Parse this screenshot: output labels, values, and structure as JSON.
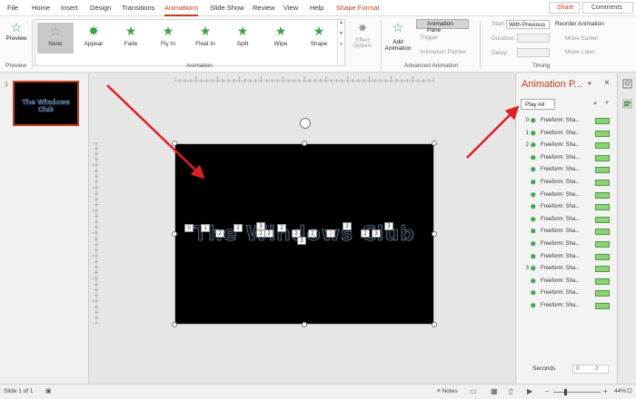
{
  "menubar": {
    "items": [
      "File",
      "Home",
      "Insert",
      "Design",
      "Transitions",
      "Animations",
      "Slide Show",
      "Review",
      "View",
      "Help",
      "Shape Format"
    ],
    "active": "Animations",
    "share": "Share",
    "comments": "Comments"
  },
  "ribbon": {
    "preview": "Preview",
    "preview_group": "Preview",
    "animations": [
      "None",
      "Appear",
      "Fade",
      "Fly In",
      "Float In",
      "Split",
      "Wipe",
      "Shape"
    ],
    "selected_animation": "None",
    "effect_options": "Effect Options",
    "animation_group": "Animation",
    "add_animation": "Add Animation",
    "animation_pane": "Animation Pane",
    "trigger": "Trigger",
    "animation_painter": "Animation Painter",
    "advanced_group": "Advanced Animation",
    "start_label": "Start:",
    "start_value": "With Previous",
    "duration_label": "Duration:",
    "delay_label": "Delay:",
    "reorder": "Reorder Animation",
    "move_earlier": "Move Earlier",
    "move_later": "Move Later",
    "timing_group": "Timing"
  },
  "thumbnails": {
    "slide_number": "1",
    "thumb_text": "The Windows Club"
  },
  "slide": {
    "title": "The Windows Club",
    "tags": [
      "0",
      "1",
      "2",
      "2",
      "3",
      "2",
      "2",
      "2",
      "2",
      "2",
      "3",
      "2",
      "2",
      "2",
      "3",
      "3"
    ]
  },
  "pane": {
    "title": "Animation P...",
    "close": "×",
    "play_all": "Play All",
    "rows": [
      {
        "num": "0",
        "label": "Freeform: Sha..."
      },
      {
        "num": "1",
        "label": "Freeform: Sha..."
      },
      {
        "num": "2",
        "label": "Freeform: Sha..."
      },
      {
        "num": "",
        "label": "Freeform: Sha..."
      },
      {
        "num": "",
        "label": "Freeform: Sha..."
      },
      {
        "num": "",
        "label": "Freeform: Sha..."
      },
      {
        "num": "",
        "label": "Freeform: Sha..."
      },
      {
        "num": "",
        "label": "Freeform: Sha..."
      },
      {
        "num": "",
        "label": "Freeform: Sha..."
      },
      {
        "num": "",
        "label": "Freeform: Sha..."
      },
      {
        "num": "",
        "label": "Freeform: Sha..."
      },
      {
        "num": "",
        "label": "Freeform: Sha..."
      },
      {
        "num": "3",
        "label": "Freeform: Sha..."
      },
      {
        "num": "",
        "label": "Freeform: Sha..."
      },
      {
        "num": "",
        "label": "Freeform: Sha..."
      },
      {
        "num": "",
        "label": "Freeform: Sha..."
      }
    ],
    "seconds": "Seconds",
    "scale_values": [
      "0",
      "2"
    ]
  },
  "status": {
    "slide_info": "Slide 1 of 1",
    "notes": "Notes",
    "zoom": "44%"
  },
  "colors": {
    "accent": "#c43e1c",
    "arrow": "#e02020",
    "star_green": "#3aa34a",
    "bar_green": "#8fd17a"
  }
}
